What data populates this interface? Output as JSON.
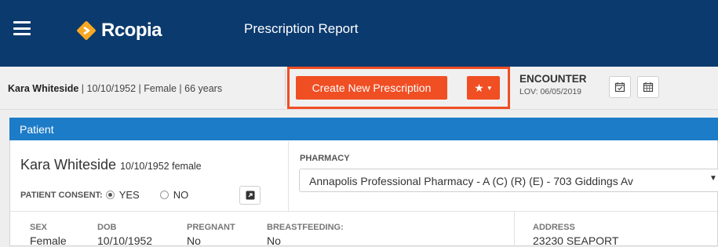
{
  "header": {
    "brand": "Rcopia",
    "title": "Prescription Report",
    "bg_color": "#0b3a6e",
    "logo_color": "#f7a823"
  },
  "strip": {
    "patient_name": "Kara Whiteside",
    "patient_details": " | 10/10/1952 | Female | 66 years",
    "create_button": "Create New Prescription",
    "favorites_icon": "star-icon",
    "encounter_title": "ENCOUNTER",
    "encounter_lov": "LOV: 06/05/2019",
    "accent_color": "#f04e23"
  },
  "panel": {
    "title": "Patient",
    "header_color": "#1d7cc8",
    "patient_name": "Kara Whiteside",
    "patient_sub": "10/10/1952 female",
    "consent_label": "PATIENT CONSENT:",
    "consent_yes": "YES",
    "consent_no": "NO",
    "consent_selected": "YES",
    "pharmacy_label": "PHARMACY",
    "pharmacy_value": "Annapolis Professional Pharmacy - A (C) (R) (E) - 703 Giddings Av",
    "fields": [
      {
        "label": "SEX",
        "value": "Female"
      },
      {
        "label": "DOB",
        "value": "10/10/1952"
      },
      {
        "label": "PREGNANT",
        "value": "No"
      },
      {
        "label": "BREASTFEEDING:",
        "value": "No"
      },
      {
        "label": "ADDRESS",
        "value": "23230 SEAPORT"
      }
    ]
  }
}
